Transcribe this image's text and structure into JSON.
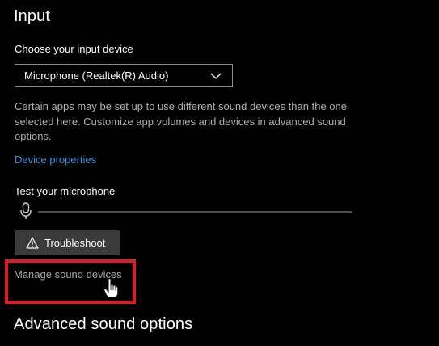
{
  "input_section": {
    "title": "Input",
    "choose_label": "Choose your input device",
    "device_select": {
      "selected": "Microphone (Realtek(R) Audio)"
    },
    "description": "Certain apps may be set up to use different sound devices than the one selected here. Customize app volumes and devices in advanced sound options.",
    "device_properties_link": "Device properties",
    "test_label": "Test your microphone",
    "mic_level_percent": 0,
    "troubleshoot_button": "Troubleshoot",
    "manage_devices_link": "Manage sound devices"
  },
  "advanced_section": {
    "title": "Advanced sound options"
  },
  "colors": {
    "background": "#000000",
    "link": "#3a8fe0",
    "highlight_box": "#e01b24",
    "button_bg": "#3a3a3a"
  },
  "icons": {
    "dropdown": "chevron-down-icon",
    "mic": "microphone-icon",
    "troubleshoot": "warning-icon",
    "cursor": "hand-cursor-icon"
  }
}
